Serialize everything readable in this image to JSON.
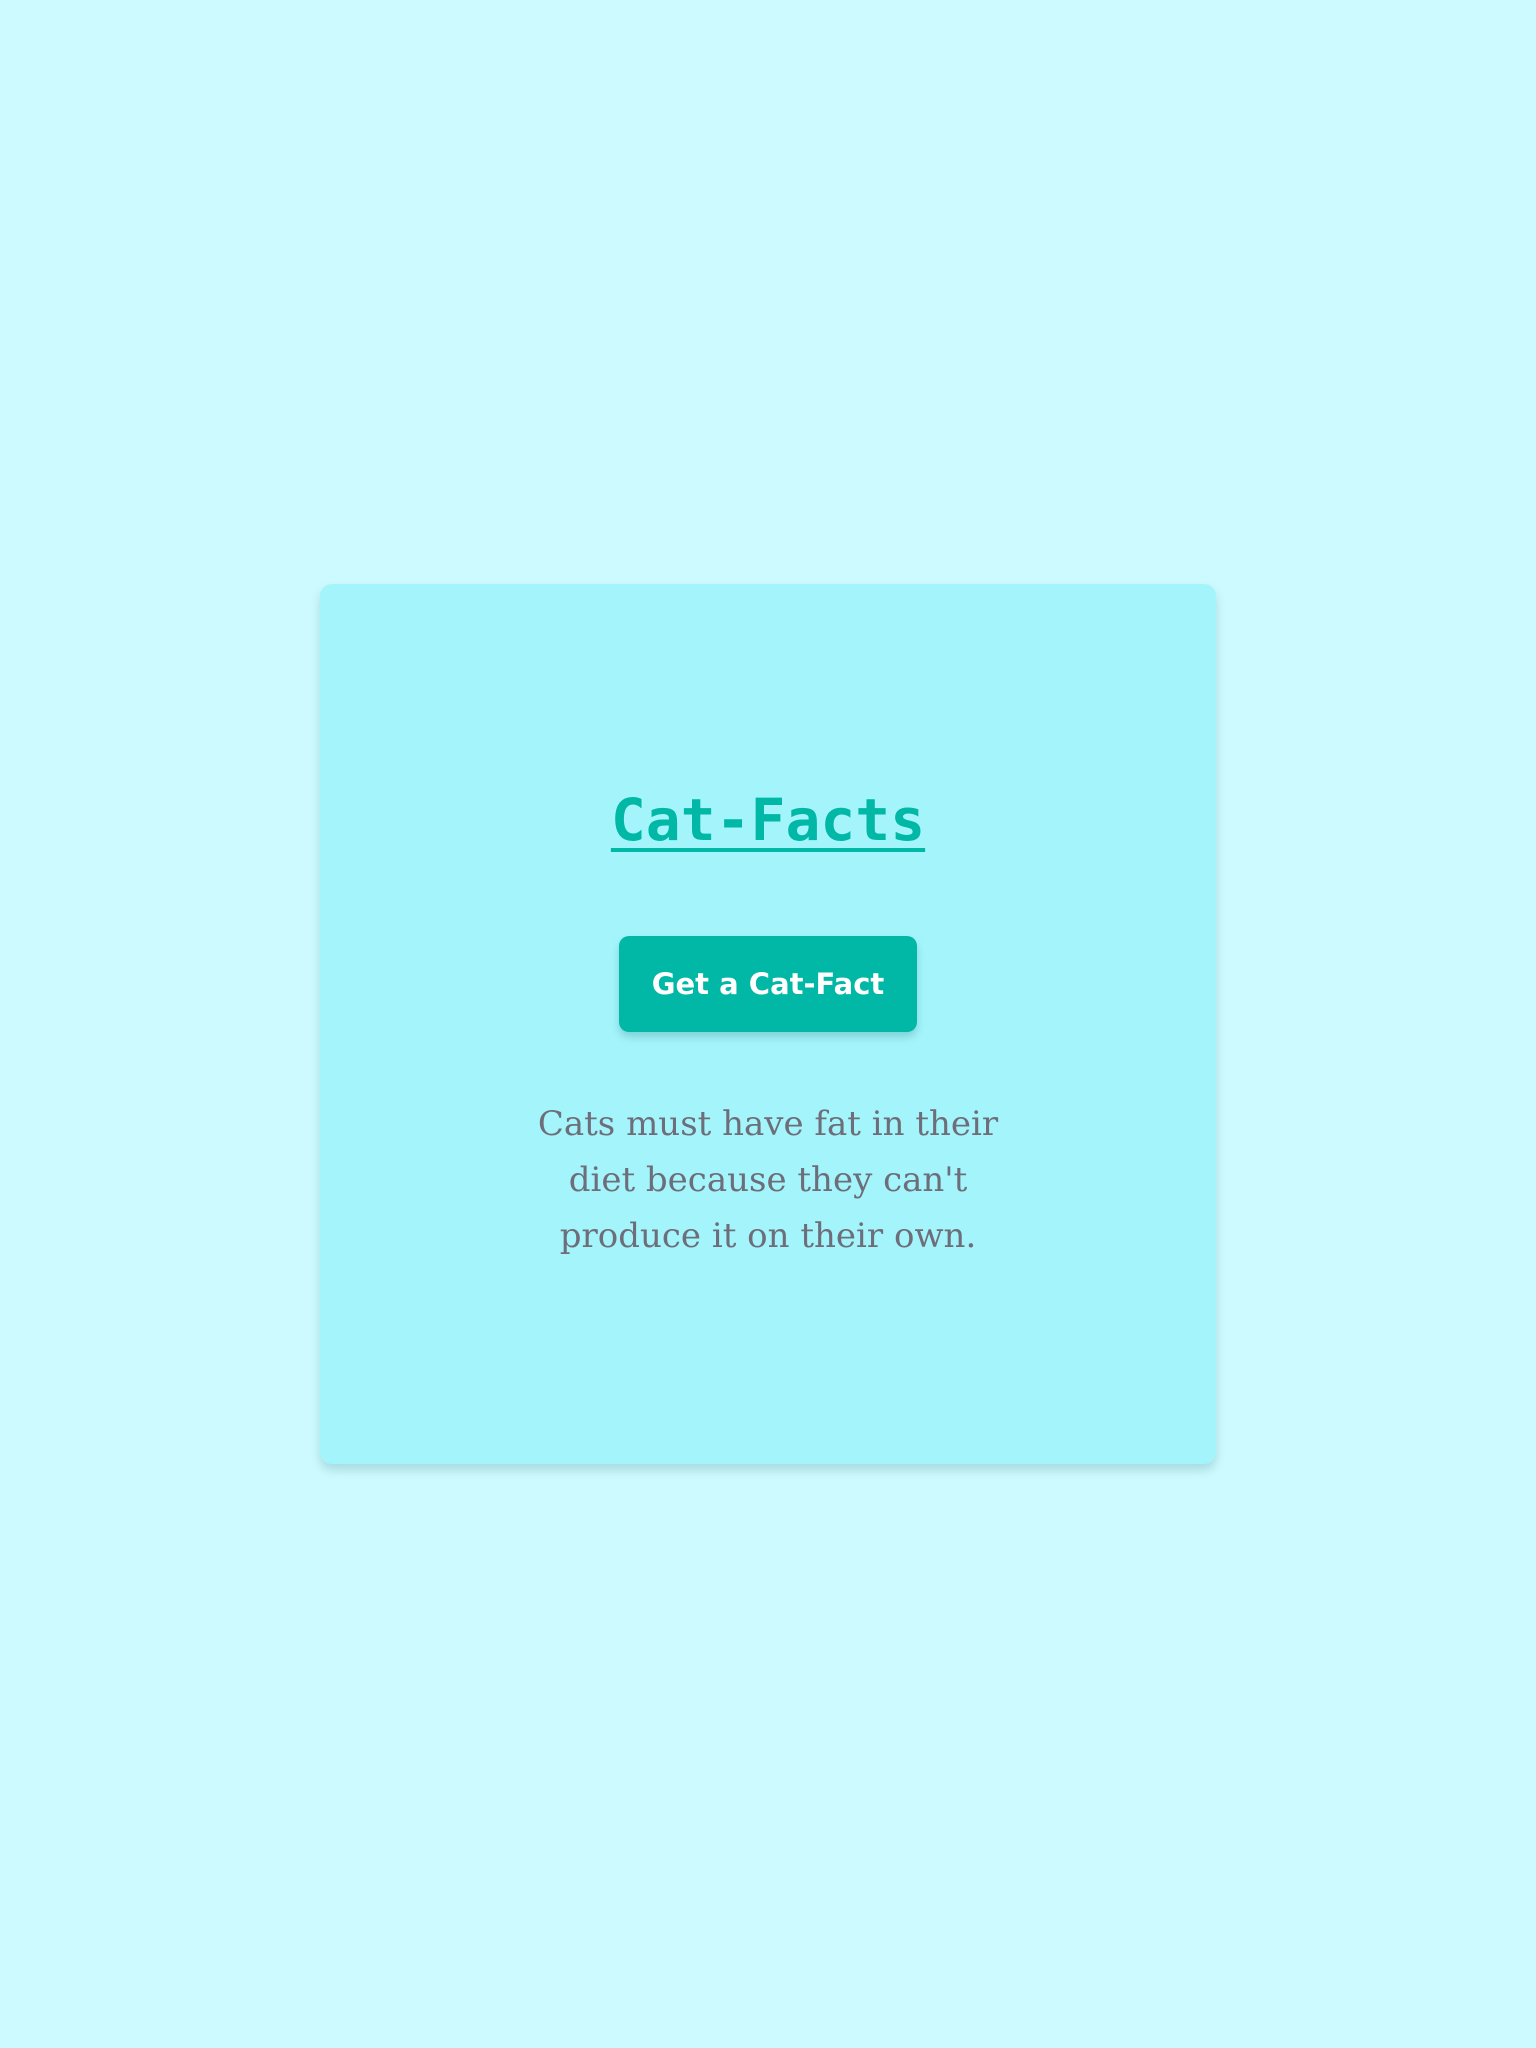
{
  "app": {
    "title": "Cat-Facts"
  },
  "actions": {
    "get_fact_label": "Get a Cat-Fact"
  },
  "fact": {
    "text": "Cats must have fat in their diet because they can't produce it on their own."
  },
  "colors": {
    "page_background": "#cdfafe",
    "card_background": "#a3f5fb",
    "accent": "#00b8a5",
    "button_text": "#ffffff",
    "fact_text": "#6e6e7a"
  }
}
